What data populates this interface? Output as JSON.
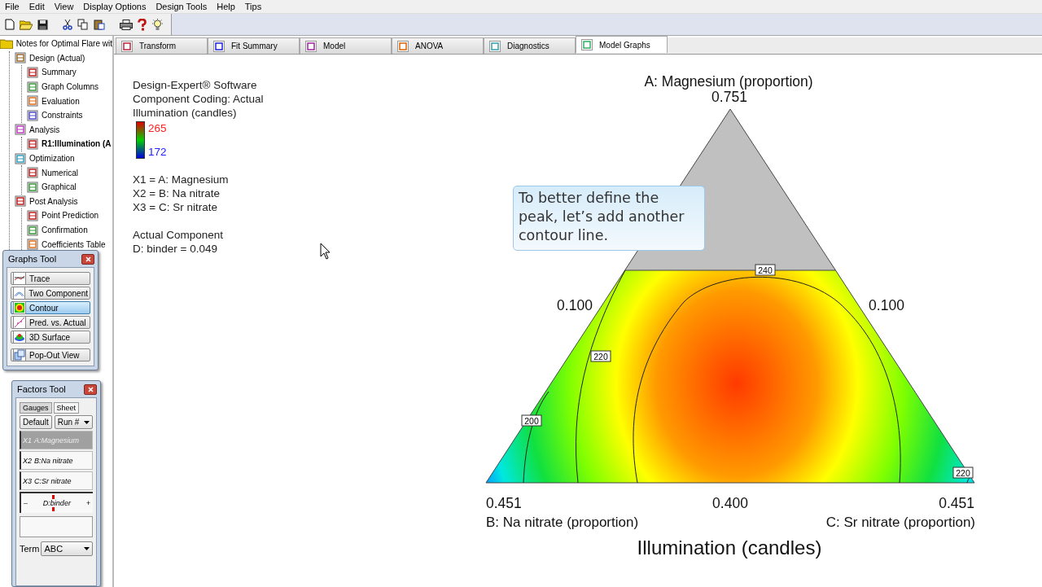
{
  "menu": [
    "File",
    "Edit",
    "View",
    "Display Options",
    "Design Tools",
    "Help",
    "Tips"
  ],
  "tree": {
    "label": "Notes for Optimal Flare wit",
    "selected": false,
    "children": [
      {
        "label": "Design (Actual)",
        "selected": false,
        "children": [
          {
            "label": "Summary",
            "selected": false
          },
          {
            "label": "Graph Columns",
            "selected": false
          },
          {
            "label": "Evaluation",
            "selected": false
          },
          {
            "label": "Constraints",
            "selected": false
          }
        ]
      },
      {
        "label": "Analysis",
        "selected": false,
        "children": [
          {
            "label": "R1:Illumination (A",
            "selected": true
          }
        ]
      },
      {
        "label": "Optimization",
        "selected": false,
        "children": [
          {
            "label": "Numerical",
            "selected": false
          },
          {
            "label": "Graphical",
            "selected": false
          }
        ]
      },
      {
        "label": "Post Analysis",
        "selected": false,
        "children": [
          {
            "label": "Point Prediction",
            "selected": false
          },
          {
            "label": "Confirmation",
            "selected": false
          },
          {
            "label": "Coefficients Table",
            "selected": false
          }
        ]
      }
    ]
  },
  "graphs_tool": {
    "title": "Graphs Tool",
    "buttons": [
      {
        "label": "Trace",
        "selected": false
      },
      {
        "label": "Two Component",
        "selected": false
      },
      {
        "label": "Contour",
        "selected": true
      },
      {
        "label": "Pred. vs. Actual",
        "selected": false
      },
      {
        "label": "3D Surface",
        "selected": false
      },
      {
        "label": "Pop-Out View",
        "selected": false
      }
    ]
  },
  "factors_tool": {
    "title": "Factors Tool",
    "tabs": [
      {
        "label": "Gauges",
        "selected": true
      },
      {
        "label": "Sheet",
        "selected": false
      }
    ],
    "default_button": "Default",
    "run_dropdown": "Run #",
    "factors": [
      {
        "code": "X1",
        "name": "A:Magnesium",
        "selected": true
      },
      {
        "code": "X2",
        "name": "B:Na nitrate",
        "selected": false
      },
      {
        "code": "X3",
        "name": "C:Sr nitrate",
        "selected": false
      }
    ],
    "binder_gauge": {
      "minus": "–",
      "label": "D:binder",
      "plus": "+",
      "level": 0.42
    },
    "term_label": "Term",
    "term_value": "ABC"
  },
  "tabs": [
    {
      "label": "Transform",
      "selected": false
    },
    {
      "label": "Fit Summary",
      "selected": false
    },
    {
      "label": "Model",
      "selected": false
    },
    {
      "label": "ANOVA",
      "selected": false
    },
    {
      "label": "Diagnostics",
      "selected": false
    },
    {
      "label": "Model Graphs",
      "selected": true
    }
  ],
  "legend": {
    "lines": [
      "Design-Expert® Software",
      "Component Coding: Actual",
      "Illumination (candles)"
    ],
    "high": "265",
    "low": "172",
    "factors": [
      "X1 = A: Magnesium",
      "X2 = B: Na nitrate",
      "X3 = C: Sr nitrate"
    ],
    "actual": [
      "Actual Component",
      "D: binder = 0.049"
    ]
  },
  "graph": {
    "top_axis": "A: Magnesium (proportion)",
    "apex": "0.751",
    "left_tick": "0.100",
    "right_tick": "0.100",
    "left_corner": "0.451",
    "base_mid": "0.400",
    "right_corner": "0.451",
    "left_axis": "B: Na nitrate (proportion)",
    "right_axis": "C: Sr nitrate (proportion)",
    "title": "Illumination (candles)",
    "contour_labels": [
      "240",
      "220",
      "200",
      "220"
    ]
  },
  "callout": "To better define the peak, let’s add another contour line."
}
